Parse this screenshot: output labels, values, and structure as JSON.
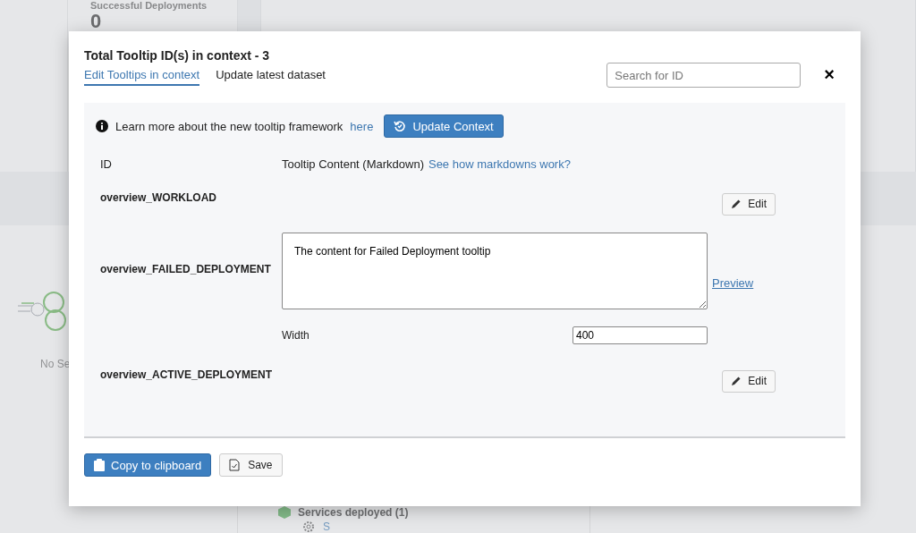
{
  "background": {
    "card_label": "Successful Deployments",
    "card_value": "0",
    "empty_text": "No Se",
    "services_title": "Services deployed (1)",
    "service_link": "S"
  },
  "modal": {
    "title": "Total Tooltip ID(s) in context - 3",
    "tabs": [
      {
        "label": "Edit Tooltips in context",
        "selected": true
      },
      {
        "label": "Update latest dataset",
        "selected": false
      }
    ],
    "search": {
      "placeholder": "Search for ID"
    },
    "close": "×",
    "info": {
      "text": "Learn more about the new tooltip framework",
      "link": "here",
      "button": "Update Context"
    },
    "columns": {
      "id": "ID",
      "content": "Tooltip Content (Markdown)",
      "help_link": "See how markdowns work?"
    },
    "rows": [
      {
        "kind": "view",
        "id": "overview_WORKLOAD",
        "button": "Edit"
      },
      {
        "kind": "editing",
        "id": "overview_FAILED_DEPLOYMENT",
        "content": "The content for Failed Deployment tooltip",
        "preview": "Preview",
        "width_label": "Width",
        "width_value": "400"
      },
      {
        "kind": "view",
        "id": "overview_ACTIVE_DEPLOYMENT",
        "button": "Edit"
      }
    ],
    "footer": {
      "copy": "Copy to clipboard",
      "save": "Save"
    }
  }
}
